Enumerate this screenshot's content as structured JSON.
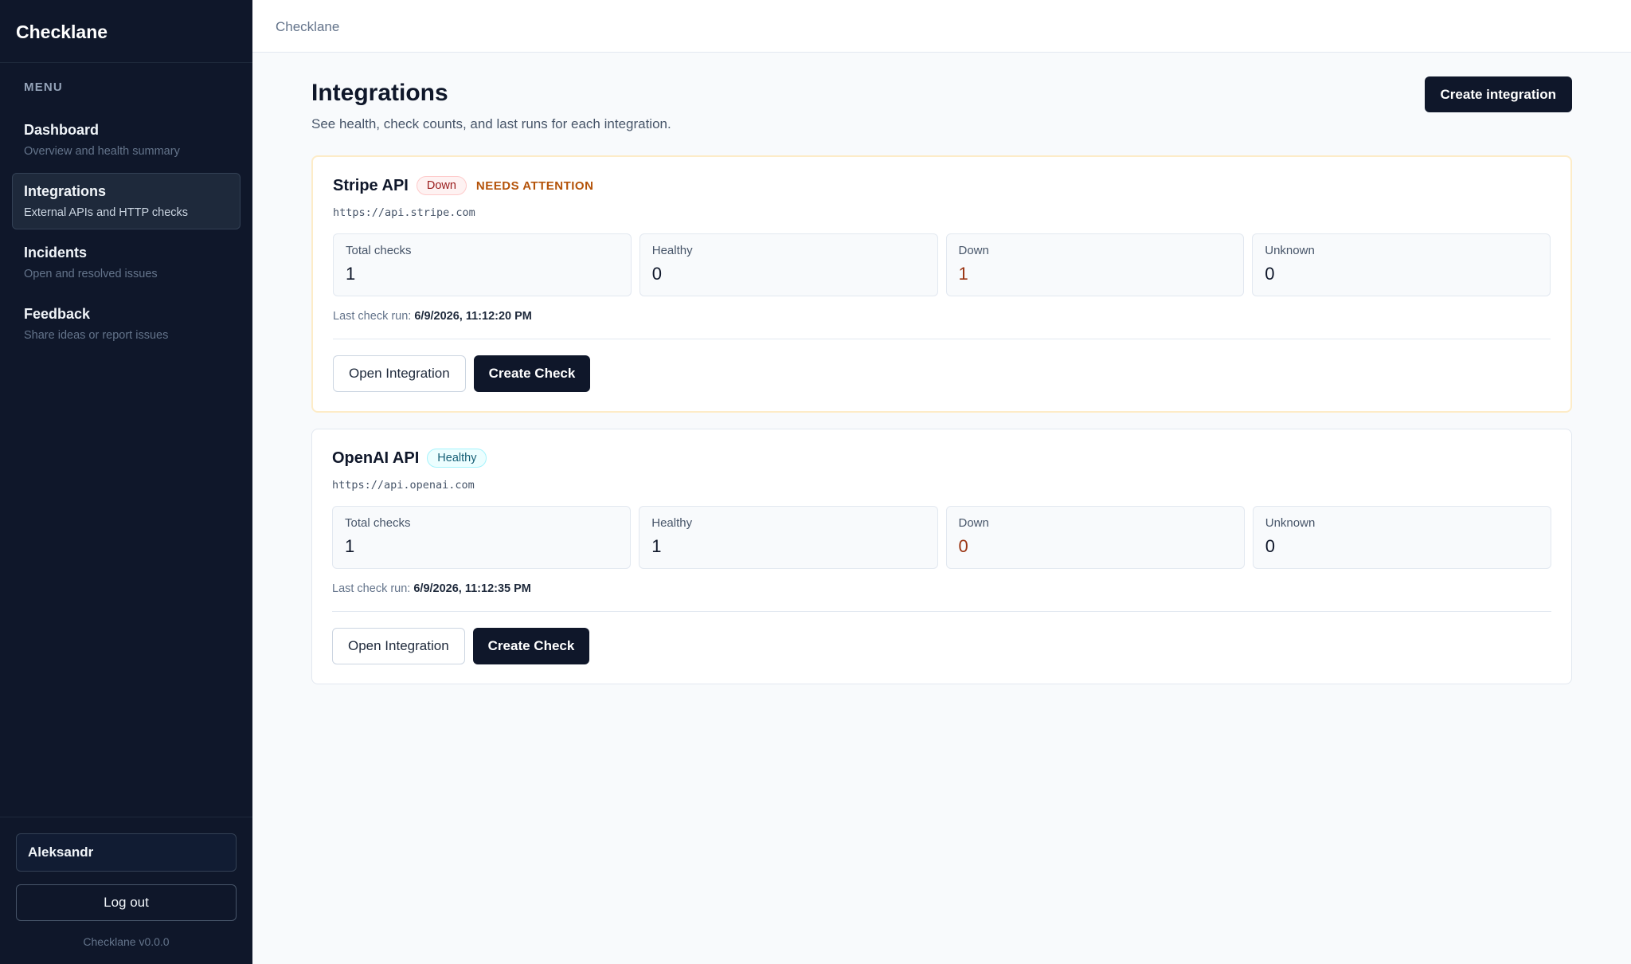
{
  "app": {
    "name": "Checklane",
    "version": "Checklane v0.0.0"
  },
  "sidebar": {
    "menu_label": "MENU",
    "items": [
      {
        "label": "Dashboard",
        "sub": "Overview and health summary",
        "active": false
      },
      {
        "label": "Integrations",
        "sub": "External APIs and HTTP checks",
        "active": true
      },
      {
        "label": "Incidents",
        "sub": "Open and resolved issues",
        "active": false
      },
      {
        "label": "Feedback",
        "sub": "Share ideas or report issues",
        "active": false
      }
    ],
    "user": "Aleksandr",
    "logout_label": "Log out"
  },
  "topbar": {
    "breadcrumb": "Checklane"
  },
  "page": {
    "title": "Integrations",
    "subtitle": "See health, check counts, and last runs for each integration.",
    "create_label": "Create integration"
  },
  "integrations": [
    {
      "name": "Stripe API",
      "status": "Down",
      "attention": "NEEDS ATTENTION",
      "url": "https://api.stripe.com",
      "stats": [
        {
          "label": "Total checks",
          "value": "1"
        },
        {
          "label": "Healthy",
          "value": "0"
        },
        {
          "label": "Down",
          "value": "1"
        },
        {
          "label": "Unknown",
          "value": "0"
        }
      ],
      "last_run_label": "Last check run:",
      "last_run": "6/9/2026, 11:12:20 PM",
      "open_label": "Open Integration",
      "create_check_label": "Create Check"
    },
    {
      "name": "OpenAI API",
      "status": "Healthy",
      "url": "https://api.openai.com",
      "stats": [
        {
          "label": "Total checks",
          "value": "1"
        },
        {
          "label": "Healthy",
          "value": "1"
        },
        {
          "label": "Down",
          "value": "0"
        },
        {
          "label": "Unknown",
          "value": "0"
        }
      ],
      "last_run_label": "Last check run:",
      "last_run": "6/9/2026, 11:12:35 PM",
      "open_label": "Open Integration",
      "create_check_label": "Create Check"
    }
  ],
  "colors": {
    "sidebar_bg": "#0f172a",
    "primary": "#0f172a",
    "down_text": "#9a3412",
    "attention": "#b45309",
    "healthy_badge": "#155e75"
  }
}
